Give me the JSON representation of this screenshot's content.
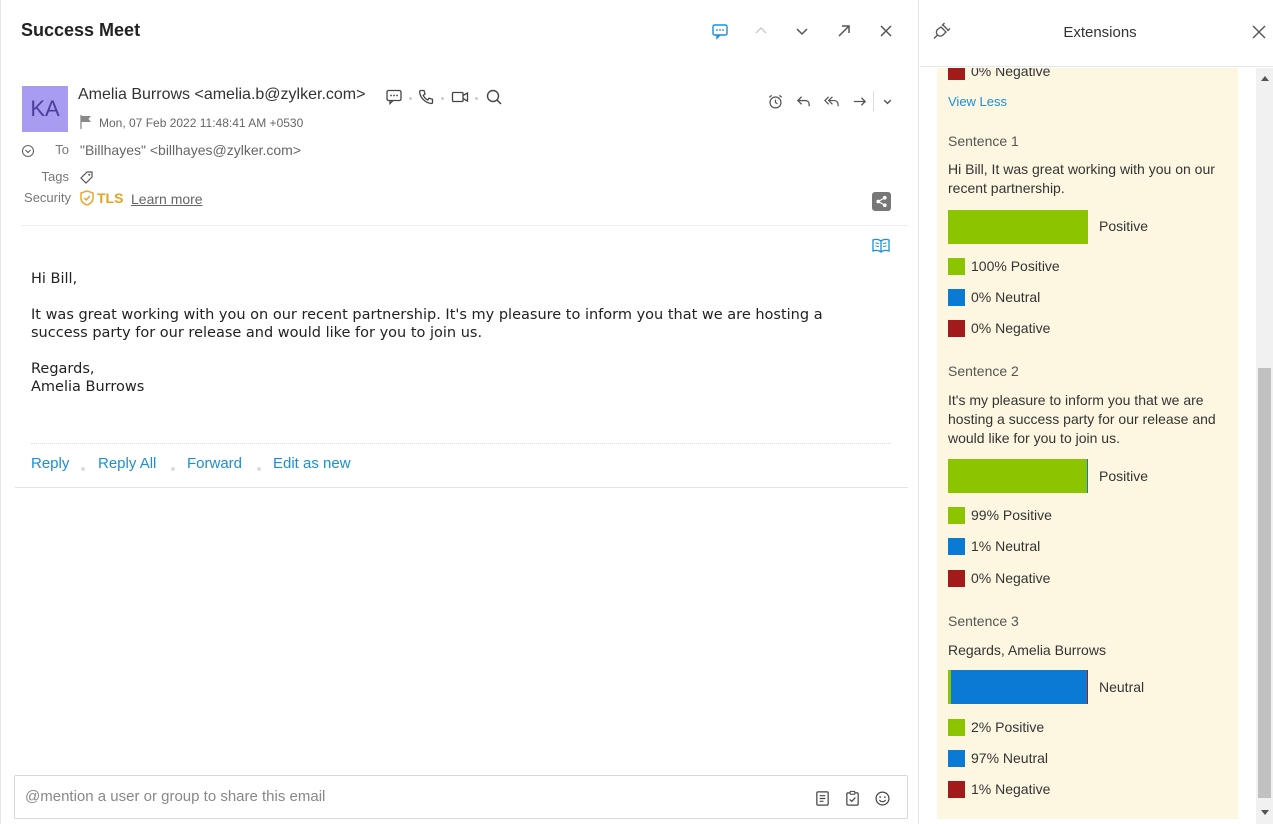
{
  "mail": {
    "subject": "Success Meet",
    "avatar_initials": "KA",
    "sender": "Amelia Burrows <amelia.b@zylker.com>",
    "date": "Mon, 07 Feb 2022 11:48:41 AM +0530",
    "to_label": "To",
    "to_value": "\"Billhayes\" <billhayes@zylker.com>",
    "tags_label": "Tags",
    "security_label": "Security",
    "tls_label": "TLS",
    "learn_more": "Learn more",
    "body": {
      "greeting": "Hi Bill,",
      "paragraph": "It was great working with you on our recent partnership. It's my pleasure to inform you that we are hosting a success party for our release and would like for you to join us.",
      "closing": "Regards,",
      "signature": "Amelia Burrows"
    },
    "links": {
      "reply": "Reply",
      "reply_all": "Reply All",
      "forward": "Forward",
      "edit_as_new": "Edit as new"
    },
    "mention_placeholder": "@mention a user or group to share this email"
  },
  "extensions": {
    "title": "Extensions",
    "view_less": "View Less",
    "top_negative": "0% Negative",
    "colors": {
      "positive": "#8cc400",
      "neutral": "#0a7ad4",
      "negative": "#a31a1a"
    },
    "sentences": [
      {
        "heading": "Sentence 1",
        "text": "Hi Bill, It was great working with you on our recent partnership.",
        "result": "Positive",
        "positive": 100,
        "neutral": 0,
        "negative": 0,
        "positive_label": "100% Positive",
        "neutral_label": "0% Neutral",
        "negative_label": "0% Negative"
      },
      {
        "heading": "Sentence 2",
        "text": "It's my pleasure to inform you that we are hosting a success party for our release and would like for you to join us.",
        "result": "Positive",
        "positive": 99,
        "neutral": 1,
        "negative": 0,
        "positive_label": "99% Positive",
        "neutral_label": "1% Neutral",
        "negative_label": "0% Negative"
      },
      {
        "heading": "Sentence 3",
        "text": "Regards, Amelia Burrows",
        "result": "Neutral",
        "positive": 2,
        "neutral": 97,
        "negative": 1,
        "positive_label": "2% Positive",
        "neutral_label": "97% Neutral",
        "negative_label": "1% Negative"
      }
    ]
  }
}
